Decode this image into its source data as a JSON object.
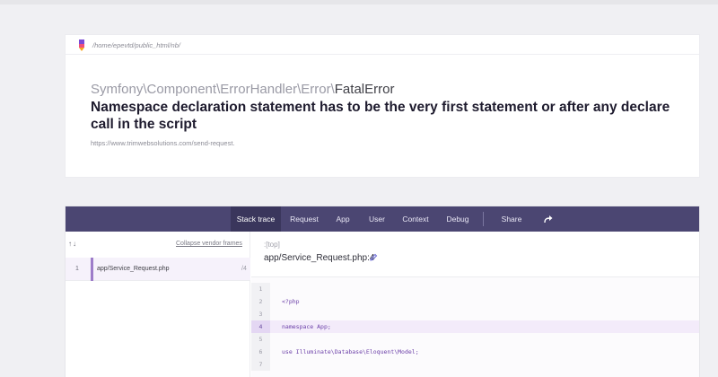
{
  "top": {
    "text": "...  ...  ..."
  },
  "error": {
    "path": "/home/epevtd/public_html/nb/",
    "exception_prefix": "Symfony\\Component\\ErrorHandler\\Error\\",
    "exception_class": "FatalError",
    "message": "Namespace declaration statement has to be the very first statement or after any declare call in the script",
    "url": "https://www.trimwebsolutions.com/send-request."
  },
  "nav": {
    "tabs": [
      "Stack trace",
      "Request",
      "App",
      "User",
      "Context",
      "Debug"
    ],
    "share_label": "Share",
    "active_tab": "Stack trace"
  },
  "frames_panel": {
    "arrows": "↑↓",
    "collapse_label": "Collapse vendor frames",
    "frames": [
      {
        "num": "1",
        "file": "app/Service_Request.php",
        "line": "/4"
      }
    ]
  },
  "source": {
    "location_label": ":[top]",
    "file": "app/Service_Request.php:4",
    "highlight_line": "4",
    "lines": [
      {
        "num": "1",
        "code": ""
      },
      {
        "num": "2",
        "code": "<?php"
      },
      {
        "num": "3",
        "code": ""
      },
      {
        "num": "4",
        "code": "namespace App;"
      },
      {
        "num": "5",
        "code": ""
      },
      {
        "num": "6",
        "code": "use Illuminate\\Database\\Eloquent\\Model;"
      },
      {
        "num": "7",
        "code": ""
      }
    ]
  },
  "colors": {
    "nav_bg": "#4b4672",
    "nav_active": "#3a365c",
    "accent": "#9d7cc9"
  }
}
